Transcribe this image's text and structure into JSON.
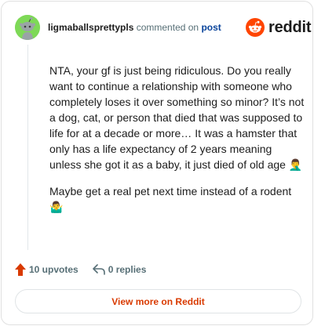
{
  "header": {
    "username": "ligmaballsprettypls",
    "commented_text": "commented on",
    "post_link": "post",
    "brand": "reddit"
  },
  "comment": {
    "paragraphs": [
      "NTA, your gf is just being ridiculous. Do you really want to continue a relationship with someone who completely loses it over something so minor? It’s not a dog, cat, or person that died that was supposed to life for at a decade or more… It was a hamster that only has a life expectancy of 2 years meaning unless she got it as a baby, it just died of old age 🤦‍♂️",
      "Maybe get a real pet next time instead of a rodent 🤷‍♂️"
    ]
  },
  "actions": {
    "upvotes": "10 upvotes",
    "replies": "0 replies"
  },
  "footer": {
    "view_more": "View more on Reddit"
  },
  "icons": {
    "avatar": "snoo-avatar-icon",
    "brand": "reddit-logo-icon",
    "upvote": "upvote-arrow-icon",
    "reply": "reply-arrow-icon"
  },
  "colors": {
    "brand_orange": "#ff4500",
    "upvote_red": "#d93a00",
    "avatar_green": "#7ed957",
    "link_blue": "#0a449b"
  }
}
